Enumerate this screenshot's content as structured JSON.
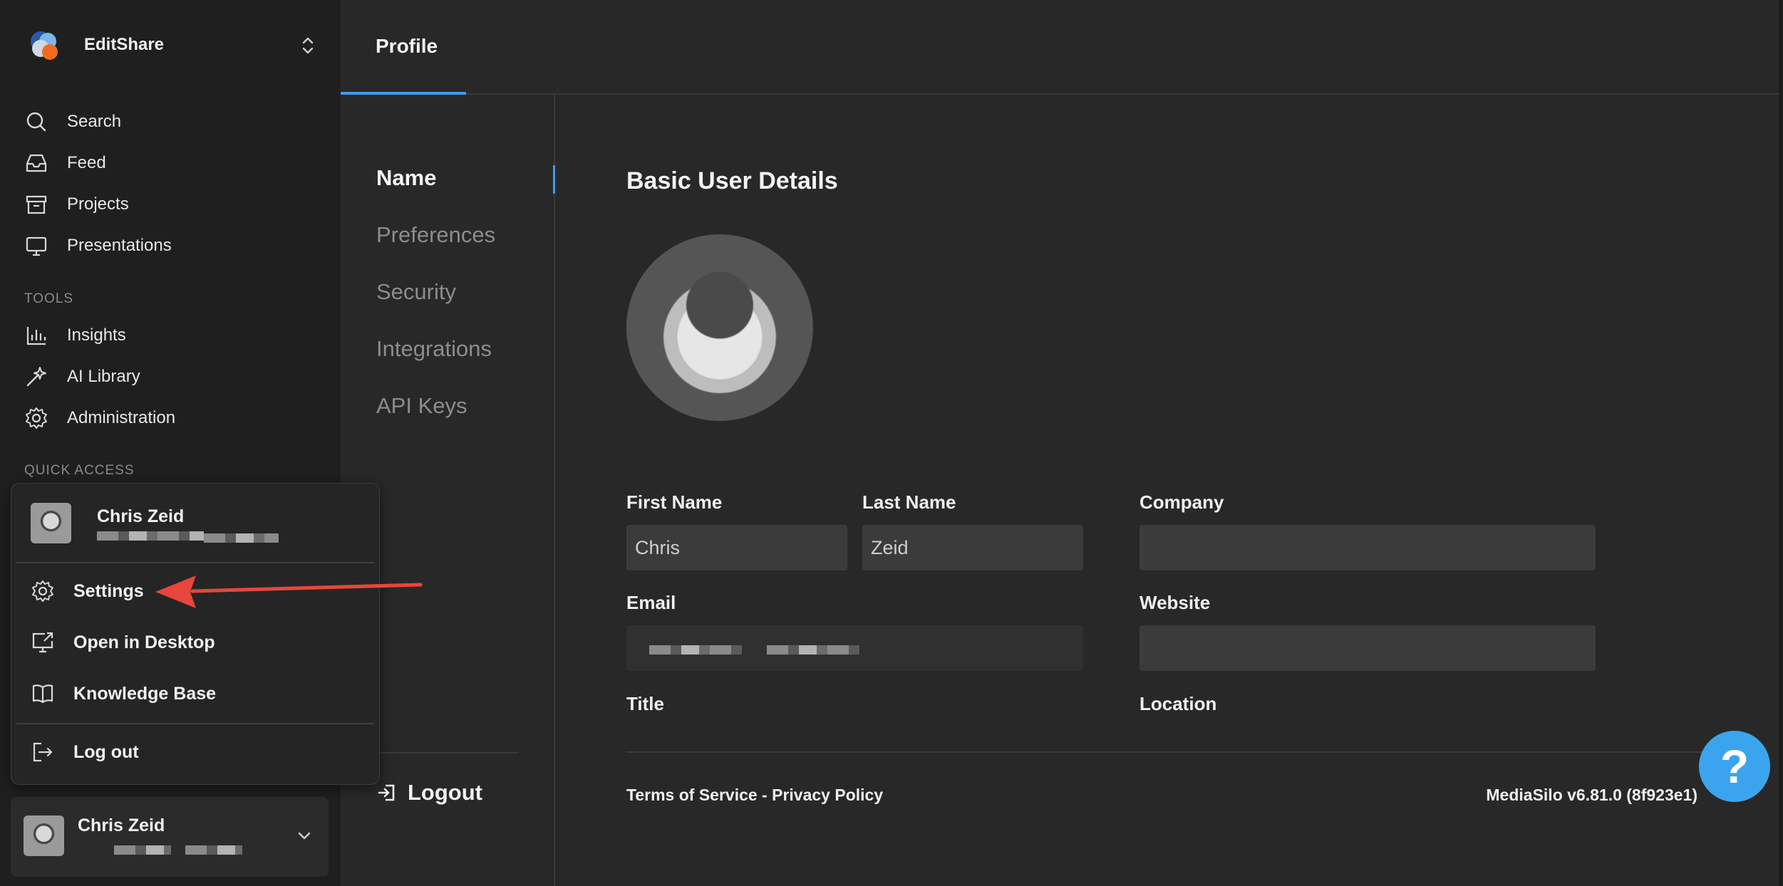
{
  "brand": {
    "name": "EditShare"
  },
  "sidebar": {
    "nav": [
      {
        "label": "Search",
        "icon": "search-icon"
      },
      {
        "label": "Feed",
        "icon": "inbox-icon"
      },
      {
        "label": "Projects",
        "icon": "archive-box-icon"
      },
      {
        "label": "Presentations",
        "icon": "monitor-icon"
      }
    ],
    "tools_label": "TOOLS",
    "tools": [
      {
        "label": "Insights",
        "icon": "bar-chart-icon"
      },
      {
        "label": "AI Library",
        "icon": "sparkle-wand-icon"
      },
      {
        "label": "Administration",
        "icon": "gear-icon"
      }
    ],
    "quick_access_label": "QUICK ACCESS"
  },
  "account_menu": {
    "user_name": "Chris Zeid",
    "items": [
      {
        "label": "Settings",
        "icon": "gear-icon"
      },
      {
        "label": "Open in Desktop",
        "icon": "external-monitor-icon"
      },
      {
        "label": "Knowledge Base",
        "icon": "book-icon"
      },
      {
        "label": "Log out",
        "icon": "logout-icon"
      }
    ]
  },
  "user_footer": {
    "name": "Chris Zeid"
  },
  "tabs": {
    "profile": "Profile"
  },
  "settings_nav": {
    "items": [
      "Name",
      "Preferences",
      "Security",
      "Integrations",
      "API Keys"
    ],
    "active": "Name",
    "logout": "Logout"
  },
  "form": {
    "section_title": "Basic User Details",
    "first_name_label": "First Name",
    "first_name_value": "Chris",
    "last_name_label": "Last Name",
    "last_name_value": "Zeid",
    "company_label": "Company",
    "company_value": "",
    "email_label": "Email",
    "website_label": "Website",
    "website_value": "",
    "title_label": "Title",
    "location_label": "Location"
  },
  "footer": {
    "terms": "Terms of Service",
    "separator": " - ",
    "privacy": "Privacy Policy",
    "version": "MediaSilo v6.81.0 (8f923e1)"
  },
  "help": {
    "label": "?"
  },
  "colors": {
    "accent": "#3b9cf0",
    "help_button": "#3aa5ee",
    "annotation_arrow": "#e8453c"
  }
}
